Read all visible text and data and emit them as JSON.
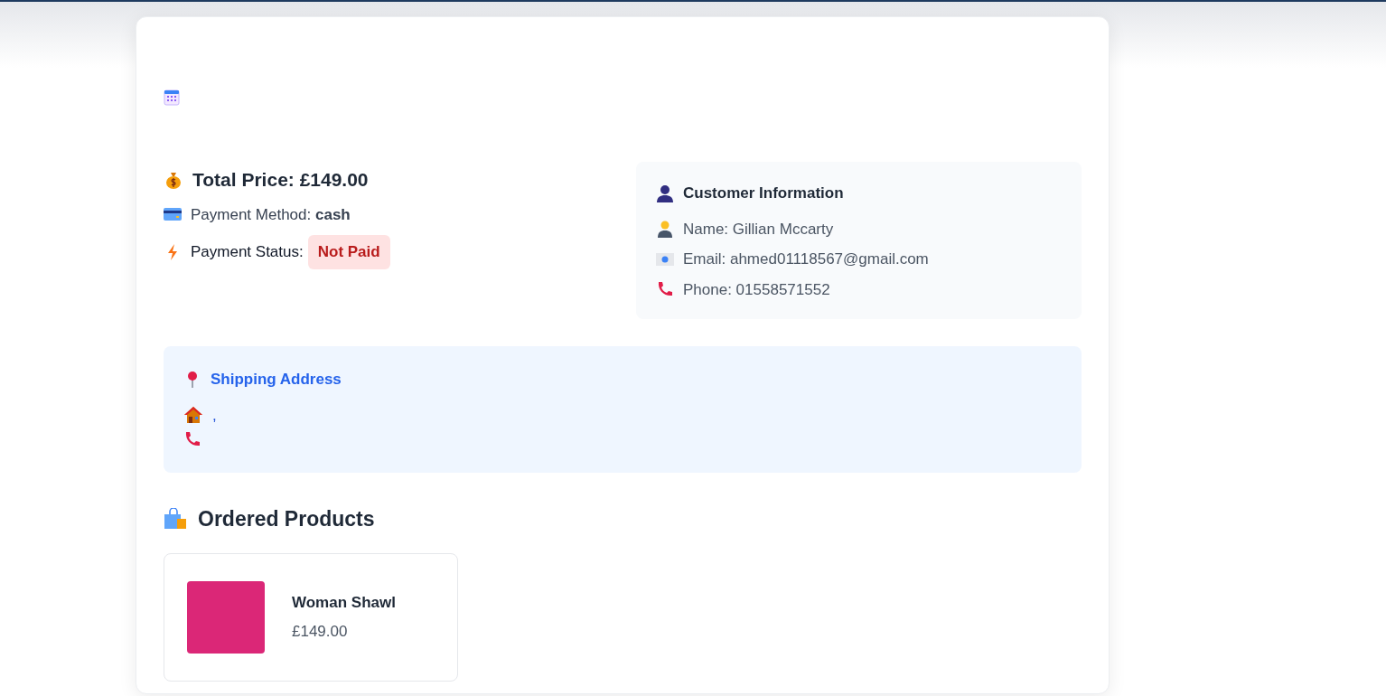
{
  "order": {
    "total_price": "Total Price: £149.00",
    "payment_method": "Payment Method: **cash**",
    "payment_status_label": "Payment Status:",
    "payment_status": "Not Paid",
    "paid": false
  },
  "customer": {
    "title": "Customer Information",
    "name": "Name: Gillian Mccarty",
    "email": "Email: ahmed01118567@gmail.com",
    "phone": "Phone: 01558571552"
  },
  "shipping": {
    "title": "Shipping Address",
    "address": ","
  },
  "products_title": "Ordered Products",
  "products": [
    {
      "name": "Woman Shawl",
      "price": "£149.00"
    }
  ]
}
